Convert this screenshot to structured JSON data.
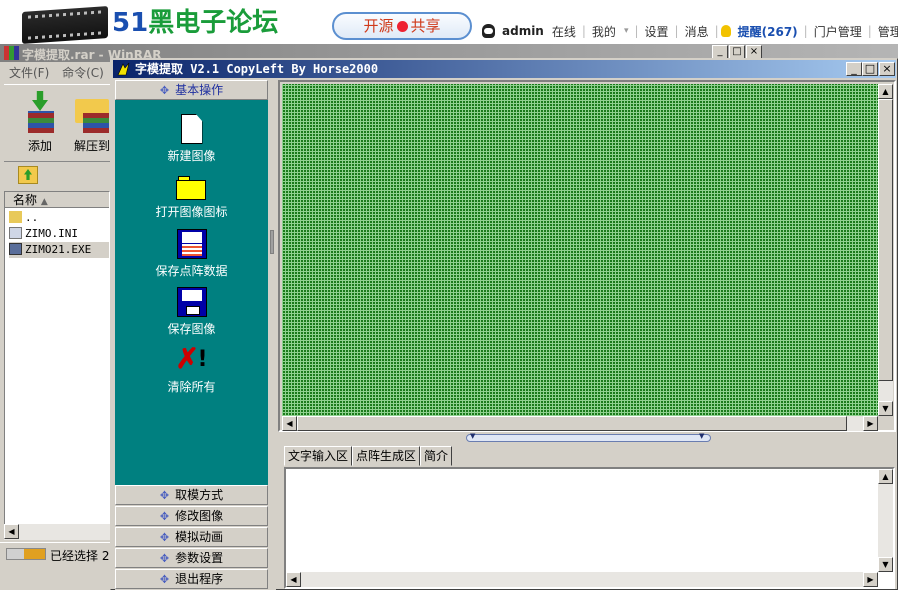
{
  "forum": {
    "site_number": "51",
    "site_name": "黑电子论坛",
    "badge_left": "开源",
    "badge_right": "共享",
    "user": "admin",
    "user_status": "在线",
    "nav_mine": "我的",
    "nav_settings": "设置",
    "nav_messages": "消息",
    "nav_remind": "提醒(267)",
    "nav_portal": "门户管理",
    "nav_manage": "管理"
  },
  "winrar": {
    "title": "字模提取.rar - WinRAR",
    "menu": [
      "文件(F)",
      "命令(C)"
    ],
    "toolbar": {
      "add_label": "添加",
      "extract_label": "解压到"
    },
    "column_name": "名称",
    "files": [
      {
        "name": ".."
      },
      {
        "name": "ZIMO.INI"
      },
      {
        "name": "ZIMO21.EXE"
      }
    ],
    "status": "已经选择 2"
  },
  "zimo": {
    "title": "字模提取 V2.1  CopyLeft By Horse2000",
    "window_buttons": {
      "minimize": "_",
      "maximize": "□",
      "close": "×"
    },
    "sidebar": {
      "header": "基本操作",
      "actions": [
        {
          "label": "新建图像",
          "icon": "new-image-icon"
        },
        {
          "label": "打开图像图标",
          "icon": "open-folder-icon"
        },
        {
          "label": "保存点阵数据",
          "icon": "save-data-floppy-icon"
        },
        {
          "label": "保存图像",
          "icon": "save-image-floppy-icon"
        },
        {
          "label": "清除所有",
          "icon": "clear-all-icon"
        }
      ],
      "sections": [
        "取模方式",
        "修改图像",
        "模拟动画",
        "参数设置",
        "退出程序"
      ]
    },
    "tabs": [
      "文字输入区",
      "点阵生成区",
      "简介"
    ],
    "text_input_value": ""
  },
  "colors": {
    "sidebar_bg": "#008080",
    "grid_bg": "#1a7a1a",
    "title_active": "#0a246a"
  }
}
